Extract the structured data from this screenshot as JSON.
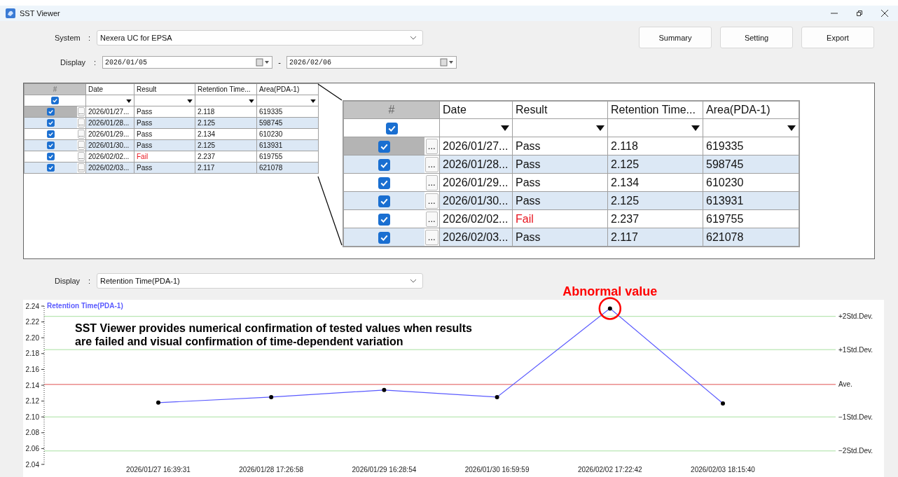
{
  "window": {
    "title": "SST Viewer"
  },
  "system": {
    "label": "System",
    "separator": ":",
    "value": "Nexera UC for EPSA"
  },
  "buttons": [
    "Summary",
    "Setting",
    "Export"
  ],
  "date_range": {
    "label": "Display",
    "separator": ":",
    "from": "2026/01/05",
    "dash": "-",
    "to": "2026/02/06"
  },
  "table": {
    "columns": [
      "#",
      "Date",
      "Result",
      "Retention Time...",
      "Area(PDA-1)"
    ],
    "all_checked": true,
    "rows": [
      {
        "checked": true,
        "selected": true,
        "button": "...",
        "date": "2026/01/27...",
        "result": "Pass",
        "failed": false,
        "retention_time": "2.118",
        "area": "619335"
      },
      {
        "checked": true,
        "selected": false,
        "button": "...",
        "date": "2026/01/28...",
        "result": "Pass",
        "failed": false,
        "retention_time": "2.125",
        "area": "598745"
      },
      {
        "checked": true,
        "selected": false,
        "button": "...",
        "date": "2026/01/29...",
        "result": "Pass",
        "failed": false,
        "retention_time": "2.134",
        "area": "610230"
      },
      {
        "checked": true,
        "selected": false,
        "button": "...",
        "date": "2026/01/30...",
        "result": "Pass",
        "failed": false,
        "retention_time": "2.125",
        "area": "613931"
      },
      {
        "checked": true,
        "selected": false,
        "button": "...",
        "date": "2026/02/02...",
        "result": "Fail",
        "failed": true,
        "retention_time": "2.237",
        "area": "619755"
      },
      {
        "checked": true,
        "selected": false,
        "button": "...",
        "date": "2026/02/03...",
        "result": "Pass",
        "failed": false,
        "retention_time": "2.117",
        "area": "621078"
      }
    ]
  },
  "magnified_table": {
    "columns": [
      "#",
      "Date",
      "Result",
      "Retention Time...",
      "Area(PDA-1)"
    ],
    "all_checked": true,
    "rows": [
      {
        "checked": true,
        "selected": true,
        "button": "...",
        "date": "2026/01/27...",
        "result": "Pass",
        "failed": false,
        "retention_time": "2.118",
        "area": "619335"
      },
      {
        "checked": true,
        "selected": false,
        "button": "...",
        "date": "2026/01/28...",
        "result": "Pass",
        "failed": false,
        "retention_time": "2.125",
        "area": "598745"
      },
      {
        "checked": true,
        "selected": false,
        "button": "...",
        "date": "2026/01/29...",
        "result": "Pass",
        "failed": false,
        "retention_time": "2.134",
        "area": "610230"
      },
      {
        "checked": true,
        "selected": false,
        "button": "...",
        "date": "2026/01/30...",
        "result": "Pass",
        "failed": false,
        "retention_time": "2.125",
        "area": "613931"
      },
      {
        "checked": true,
        "selected": false,
        "button": "...",
        "date": "2026/02/02...",
        "result": "Fail",
        "failed": true,
        "retention_time": "2.237",
        "area": "619755"
      },
      {
        "checked": true,
        "selected": false,
        "button": "...",
        "date": "2026/02/03...",
        "result": "Pass",
        "failed": false,
        "retention_time": "2.117",
        "area": "621078"
      }
    ]
  },
  "display": {
    "label": "Display",
    "separator": ":",
    "value": "Retention Time(PDA-1)"
  },
  "chart": {
    "chart_data": {
      "type": "line",
      "categories": [
        "2026/01/27 16:39:31",
        "2026/01/28 17:26:58",
        "2026/01/29 16:28:54",
        "2026/01/30 16:59:59",
        "2026/02/02 17:22:42",
        "2026/02/03 18:15:40"
      ],
      "series": [
        {
          "name": "Retention Time(PDA-1)",
          "color": "#5a5aff",
          "marker": "circle",
          "values": [
            2.118,
            2.125,
            2.134,
            2.125,
            2.237,
            2.117
          ]
        }
      ],
      "ylim": [
        2.04,
        2.24
      ],
      "yticks": [
        {
          "value": 2.04,
          "label": "2.04"
        },
        {
          "value": 2.06,
          "label": "2.06"
        },
        {
          "value": 2.08,
          "label": "2.08"
        },
        {
          "value": 2.1,
          "label": "2.10"
        },
        {
          "value": 2.12,
          "label": "2.12"
        },
        {
          "value": 2.14,
          "label": "2.14"
        },
        {
          "value": 2.16,
          "label": "2.16"
        },
        {
          "value": 2.18,
          "label": "2.18"
        },
        {
          "value": 2.2,
          "label": "2.20"
        },
        {
          "value": 2.22,
          "label": "2.22"
        },
        {
          "value": 2.24,
          "label": "2.24"
        }
      ],
      "ref_lines": [
        {
          "axis": "y",
          "value": 2.227,
          "label": "+2Std.Dev.",
          "color": "#a8e0a0"
        },
        {
          "axis": "y",
          "value": 2.185,
          "label": "+1Std.Dev.",
          "color": "#a8e0a0"
        },
        {
          "axis": "y",
          "value": 2.141,
          "label": "Ave.",
          "color": "#e05050"
        },
        {
          "axis": "y",
          "value": 2.1,
          "label": "−1Std.Dev.",
          "color": "#a8e0a0"
        },
        {
          "axis": "y",
          "value": 2.057,
          "label": "−2Std.Dev.",
          "color": "#a8e0a0"
        }
      ],
      "annotations": [
        {
          "text": "SST Viewer provides numerical confirmation of tested values when results are failed and visual confirmation of time-dependent variation"
        },
        {
          "text": "Abnormal value",
          "x": "2026/02/02 17:22:42",
          "y": 2.237
        }
      ]
    }
  }
}
